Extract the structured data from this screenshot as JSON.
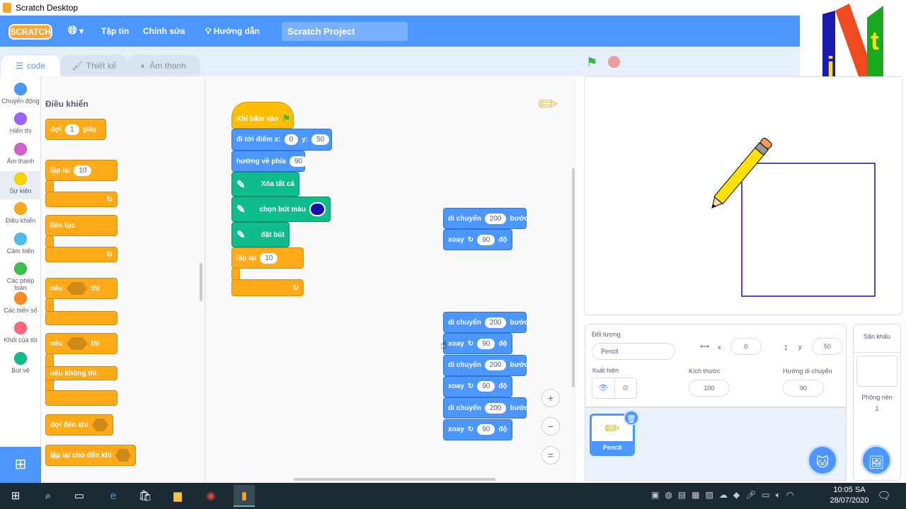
{
  "window": {
    "title": "Scratch Desktop"
  },
  "menubar": {
    "logo": "SCRATCH",
    "globe_icon": "globe-icon",
    "file": "Tập tin",
    "edit": "Chỉnh sửa",
    "tutorials": "Hướng dẫn",
    "project_title": "Scratch Project"
  },
  "tabs": [
    {
      "label": "code",
      "icon": "code-icon"
    },
    {
      "label": "Thiết kế",
      "icon": "brush-icon"
    },
    {
      "label": "Âm thanh",
      "icon": "speaker-icon"
    }
  ],
  "categories": [
    {
      "label": "Chuyển động",
      "color": "#4c97ff"
    },
    {
      "label": "Hiển thị",
      "color": "#9966ff"
    },
    {
      "label": "Âm thanh",
      "color": "#cf63cf"
    },
    {
      "label": "Sự kiện",
      "color": "#ffd500"
    },
    {
      "label": "Điều khiển",
      "color": "#ffab19"
    },
    {
      "label": "Cảm biến",
      "color": "#4cbfe6"
    },
    {
      "label": "Các phép toán",
      "color": "#40bf4a"
    },
    {
      "label": "Các biến số",
      "color": "#ff8c1a"
    },
    {
      "label": "Khối của tôi",
      "color": "#ff6680"
    },
    {
      "label": "Bút vẽ",
      "color": "#0fbd8c"
    }
  ],
  "palette": {
    "heading": "Điều khiển",
    "wait": {
      "a": "đợi",
      "v": "1",
      "b": "giây"
    },
    "repeat": {
      "a": "lặp lại",
      "v": "10"
    },
    "forever": "liên tục",
    "if": {
      "a": "nếu",
      "b": "thì"
    },
    "ifelse": {
      "a": "nếu",
      "b": "thì",
      "else": "nếu không thì"
    },
    "waituntil": "đợi đến khi",
    "repeatuntil": "lặp lại cho đến khi"
  },
  "script1": {
    "hat": "Khi bấm vào",
    "goto": {
      "a": "đi tới điểm x:",
      "x": "0",
      "b": "y:",
      "y": "50"
    },
    "point": {
      "a": "hướng về phía",
      "v": "90"
    },
    "clear": "Xóa tất cả",
    "pencolor": {
      "a": "chọn bút màu",
      "color": "#1a0fa8"
    },
    "pendown": "đặt bút",
    "repeat": {
      "a": "lặp lại",
      "v": "10"
    }
  },
  "motion": {
    "move": "di chuyển",
    "steps": "200",
    "unit": "bước",
    "turn": "xoay",
    "deg": "90",
    "degunit": "độ"
  },
  "sprite": {
    "label": "Đối tượng",
    "name": "Pencil",
    "x_label": "x",
    "x": "0",
    "y_label": "y",
    "y": "50",
    "show_label": "Xuất hiện",
    "size_label": "Kích thước",
    "size": "100",
    "dir_label": "Hướng di chuyển",
    "dir": "90",
    "thumb_name": "Pencil"
  },
  "stage_pane": {
    "title": "Sân khấu",
    "backdrop_label": "Phông nền",
    "backdrop_count": "1"
  },
  "pen_color": "#1a0fa8",
  "taskbar": {
    "time": "10:05 SA",
    "date": "28/07/2020"
  }
}
